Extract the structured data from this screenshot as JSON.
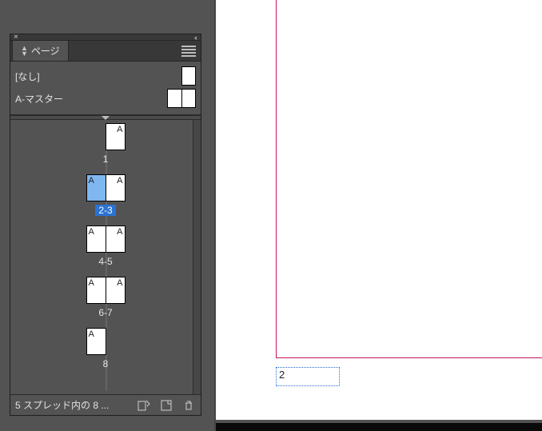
{
  "panel": {
    "title": "ページ",
    "masters": [
      {
        "label": "[なし]",
        "type": "single"
      },
      {
        "label": "A-マスター",
        "type": "double"
      }
    ],
    "spreads": [
      {
        "label": "1",
        "pages": [
          {
            "master": "A",
            "side": "r"
          }
        ],
        "selected": false
      },
      {
        "label": "2-3",
        "pages": [
          {
            "master": "A",
            "side": "l",
            "selected": true
          },
          {
            "master": "A",
            "side": "r"
          }
        ],
        "selected": true
      },
      {
        "label": "4-5",
        "pages": [
          {
            "master": "A",
            "side": "l"
          },
          {
            "master": "A",
            "side": "r"
          }
        ],
        "selected": false
      },
      {
        "label": "6-7",
        "pages": [
          {
            "master": "A",
            "side": "l"
          },
          {
            "master": "A",
            "side": "r"
          }
        ],
        "selected": false
      },
      {
        "label": "8",
        "pages": [
          {
            "master": "A",
            "side": "l"
          }
        ],
        "selected": false
      }
    ],
    "status_text": "5 スプレッド内の 8 ..."
  },
  "document": {
    "page_number_field": "2"
  }
}
